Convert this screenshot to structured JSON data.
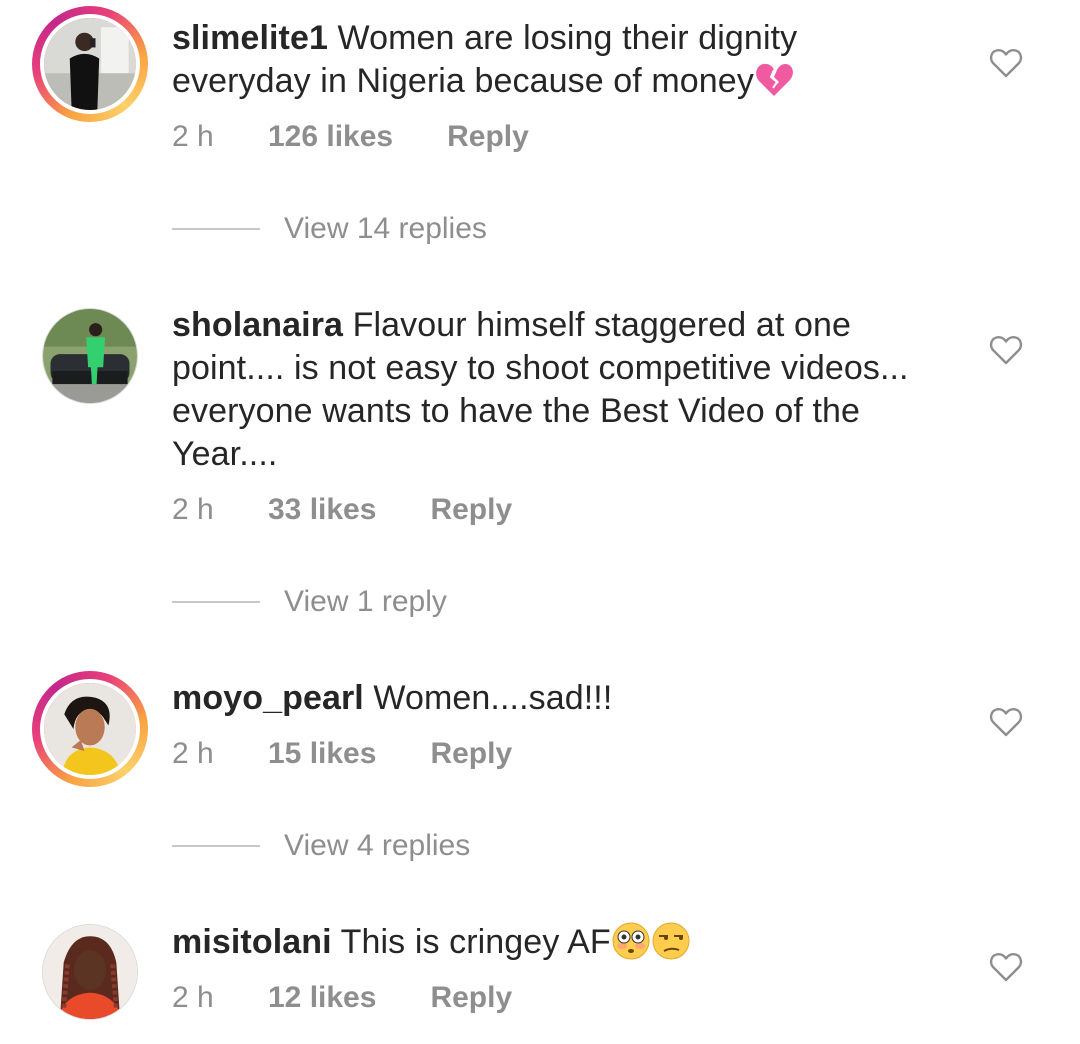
{
  "comments": [
    {
      "username": "slimelite1",
      "text": " Women are losing their dignity everyday in Nigeria because of money",
      "emojis": [
        "broken-heart"
      ],
      "time": "2 h",
      "likes": "126 likes",
      "reply_label": "Reply",
      "view_replies": "View 14 replies",
      "avatar_ring": "story"
    },
    {
      "username": "sholanaira",
      "text": " Flavour himself staggered at one point.... is not easy to shoot competitive videos... everyone wants to have the Best Video of the Year....",
      "emojis": [],
      "time": "2 h",
      "likes": "33 likes",
      "reply_label": "Reply",
      "view_replies": "View 1 reply",
      "avatar_ring": "none"
    },
    {
      "username": "moyo_pearl",
      "text": " Women....sad!!!",
      "emojis": [],
      "time": "2 h",
      "likes": "15 likes",
      "reply_label": "Reply",
      "view_replies": "View 4 replies",
      "avatar_ring": "story"
    },
    {
      "username": "misitolani",
      "text": " This is cringey AF",
      "emojis": [
        "flushed-face",
        "unamused-face"
      ],
      "time": "2 h",
      "likes": "12 likes",
      "reply_label": "Reply",
      "view_replies": "",
      "avatar_ring": "none"
    }
  ],
  "colors": {
    "text": "#262626",
    "muted": "#8e8e8e",
    "divider": "#c7c7c7",
    "story_ring_start": "#f9a341",
    "story_ring_end": "#c3278b"
  },
  "icons": {
    "like": "heart-outline-icon"
  }
}
